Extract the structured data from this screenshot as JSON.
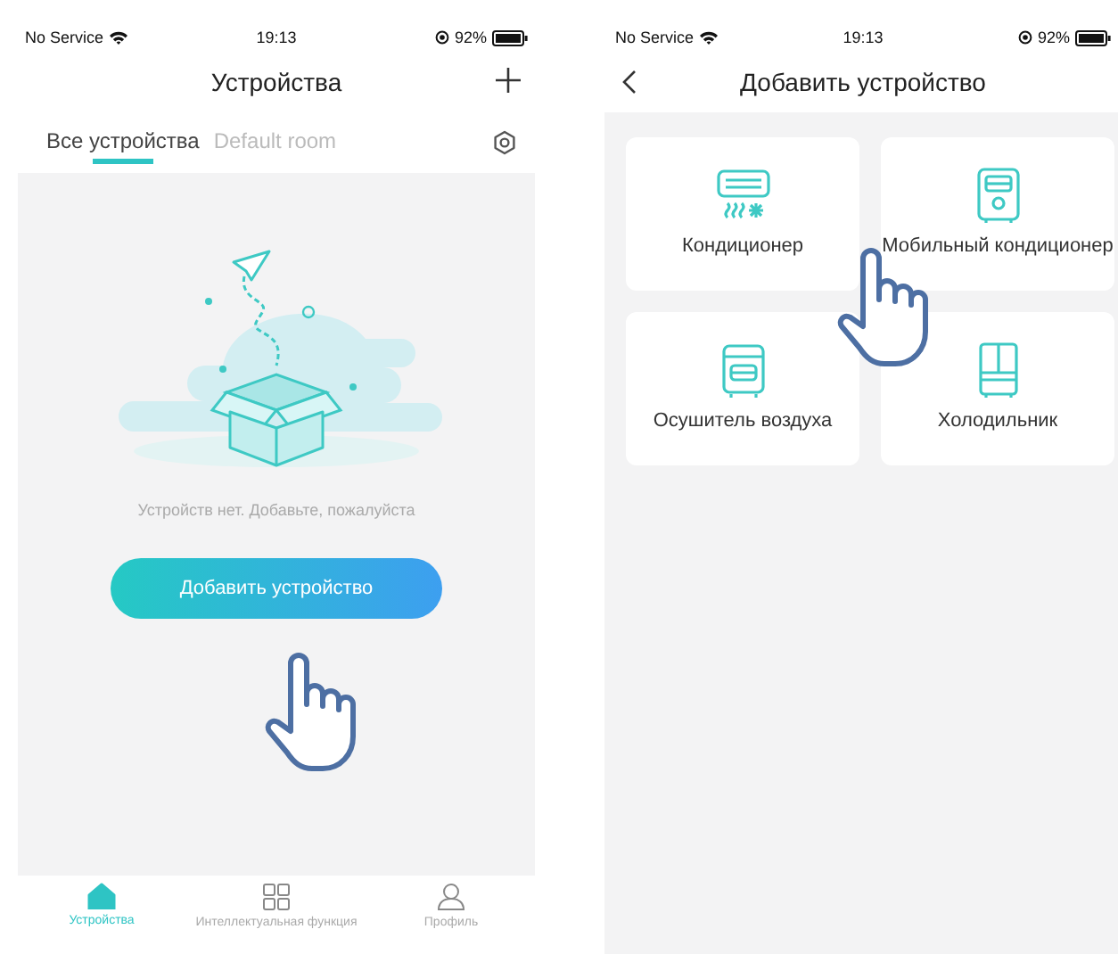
{
  "devices_screen": {
    "status_bar": {
      "carrier": "No Service",
      "time": "19:13",
      "battery": "92%"
    },
    "title": "Устройства",
    "tabs": [
      {
        "label": "Все устройства",
        "selected": true
      },
      {
        "label": "Default room",
        "selected": false
      }
    ],
    "empty_message": "Устройств нет. Добавьте, пожалуйста",
    "add_button": "Добавить устройство",
    "tab_bar": [
      {
        "label": "Устройства",
        "kind": "home",
        "selected": true
      },
      {
        "label": "Интеллектуальная функция",
        "kind": "grid",
        "selected": false
      },
      {
        "label": "Профиль",
        "kind": "person",
        "selected": false
      }
    ]
  },
  "add_device_screen": {
    "status_bar": {
      "carrier": "No Service",
      "time": "19:13",
      "battery": "92%"
    },
    "title": "Добавить устройство",
    "devices": [
      {
        "label": "Кондиционер",
        "kind": "air_conditioner"
      },
      {
        "label": "Мобильный кондиционер",
        "kind": "mobile_ac"
      },
      {
        "label": "Осушитель воздуха",
        "kind": "dehumidifier"
      },
      {
        "label": "Холодильник",
        "kind": "fridge"
      }
    ]
  }
}
